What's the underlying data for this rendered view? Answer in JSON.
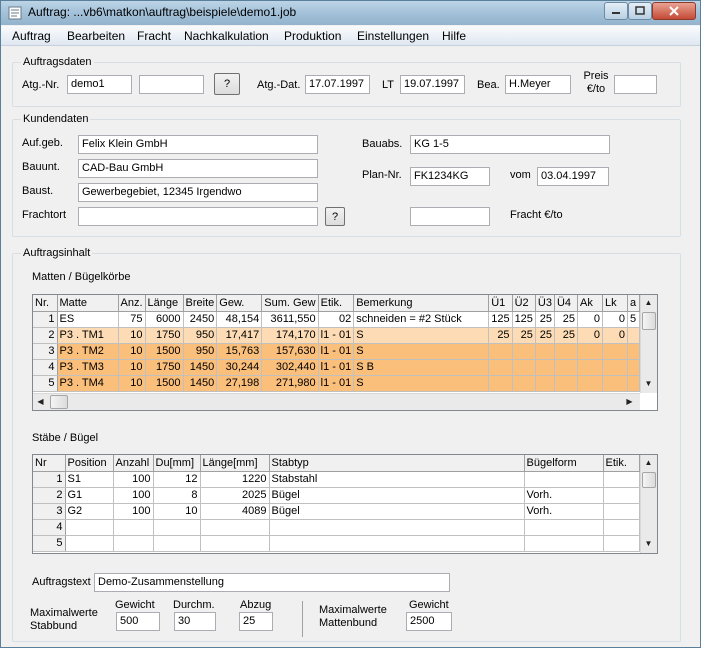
{
  "window": {
    "title": "Auftrag: ...vb6\\matkon\\auftrag\\beispiele\\demo1.job"
  },
  "menu": [
    "Auftrag",
    "Bearbeiten",
    "Fracht",
    "Nachkalkulation",
    "Produktion",
    "Einstellungen",
    "Hilfe"
  ],
  "auftragsdaten": {
    "group_label": "Auftragsdaten",
    "atg_nr_label": "Atg.-Nr.",
    "atg_nr_value": "demo1",
    "atg_nr_extra": "",
    "lookup_button": "?",
    "atg_dat_label": "Atg.-Dat.",
    "atg_dat_value": "17.07.1997",
    "lt_label": "LT",
    "lt_value": "19.07.1997",
    "bea_label": "Bea.",
    "bea_value": "H.Meyer",
    "preis_label_1": "Preis",
    "preis_label_2": "€/to",
    "preis_value": ""
  },
  "kundendaten": {
    "group_label": "Kundendaten",
    "aufgeb_label": "Auf.geb.",
    "aufgeb_value": "Felix Klein GmbH",
    "bauunt_label": "Bauunt.",
    "bauunt_value": "CAD-Bau  GmbH",
    "baust_label": "Baust.",
    "baust_value": "Gewerbegebiet, 12345 Irgendwo",
    "frachtort_label": "Frachtort",
    "frachtort_value": "",
    "frachtort_button": "?",
    "bauabs_label": "Bauabs.",
    "bauabs_value": "KG 1-5",
    "plannr_label": "Plan-Nr.",
    "plannr_value": "FK1234KG",
    "vom_label": "vom",
    "vom_value": "03.04.1997",
    "fracht_value": "",
    "fracht_label": "Fracht €/to"
  },
  "auftragsinhalt": {
    "group_label": "Auftragsinhalt",
    "matten_label": "Matten / Bügelkörbe",
    "matten_columns": [
      "Nr.",
      "Matte",
      "Anz.",
      "Länge",
      "Breite",
      "Gew.",
      "Sum. Gew",
      "Etik.",
      "Bemerkung",
      "Ü1",
      "Ü2",
      "Ü3",
      "Ü4",
      "Ak",
      "Lk",
      "a"
    ],
    "matten_rows": [
      {
        "nr": "1",
        "matte": "ES",
        "anz": "75",
        "laenge": "6000",
        "breite": "2450",
        "gew": "48,154",
        "sum": "3611,550",
        "etik": "02",
        "bem": "schneiden = #2 Stück",
        "u1": "125",
        "u2": "125",
        "u3": "25",
        "u4": "25",
        "ak": "0",
        "lk": "0",
        "a": "5"
      },
      {
        "nr": "2",
        "matte": "P3 . TM1",
        "anz": "10",
        "laenge": "1750",
        "breite": "950",
        "gew": "17,417",
        "sum": "174,170",
        "etik": "l1 - 01",
        "bem": "S",
        "u1": "25",
        "u2": "25",
        "u3": "25",
        "u4": "25",
        "ak": "0",
        "lk": "0",
        "a": ""
      },
      {
        "nr": "3",
        "matte": "P3 . TM2",
        "anz": "10",
        "laenge": "1500",
        "breite": "950",
        "gew": "15,763",
        "sum": "157,630",
        "etik": "l1 - 01",
        "bem": "S",
        "u1": "",
        "u2": "",
        "u3": "",
        "u4": "",
        "ak": "",
        "lk": "",
        "a": ""
      },
      {
        "nr": "4",
        "matte": "P3 . TM3",
        "anz": "10",
        "laenge": "1750",
        "breite": "1450",
        "gew": "30,244",
        "sum": "302,440",
        "etik": "l1 - 01",
        "bem": "S B",
        "u1": "",
        "u2": "",
        "u3": "",
        "u4": "",
        "ak": "",
        "lk": "",
        "a": ""
      },
      {
        "nr": "5",
        "matte": "P3 . TM4",
        "anz": "10",
        "laenge": "1500",
        "breite": "1450",
        "gew": "27,198",
        "sum": "271,980",
        "etik": "l1 - 01",
        "bem": "S",
        "u1": "",
        "u2": "",
        "u3": "",
        "u4": "",
        "ak": "",
        "lk": "",
        "a": ""
      }
    ],
    "staebe_label": "Stäbe / Bügel",
    "staebe_columns": [
      "Nr",
      "Position",
      "Anzahl",
      "Du[mm]",
      "Länge[mm]",
      "Stabtyp",
      "Bügelform",
      "Etik."
    ],
    "staebe_rows": [
      {
        "nr": "1",
        "pos": "S1",
        "anz": "100",
        "du": "12",
        "laenge": "1220",
        "typ": "Stabstahl",
        "form": "",
        "etik": ""
      },
      {
        "nr": "2",
        "pos": "G1",
        "anz": "100",
        "du": "8",
        "laenge": "2025",
        "typ": "Bügel",
        "form": "Vorh.",
        "etik": ""
      },
      {
        "nr": "3",
        "pos": "G2",
        "anz": "100",
        "du": "10",
        "laenge": "4089",
        "typ": "Bügel",
        "form": "Vorh.",
        "etik": ""
      },
      {
        "nr": "4",
        "pos": "",
        "anz": "",
        "du": "",
        "laenge": "",
        "typ": "",
        "form": "",
        "etik": ""
      },
      {
        "nr": "5",
        "pos": "",
        "anz": "",
        "du": "",
        "laenge": "",
        "typ": "",
        "form": "",
        "etik": ""
      }
    ],
    "auftragstext_label": "Auftragstext",
    "auftragstext_value": "Demo-Zusammenstellung",
    "maxwerte_stab_label_1": "Maximalwerte",
    "maxwerte_stab_label_2": "Stabbund",
    "gewicht_label": "Gewicht",
    "gewicht_value": "500",
    "durchm_label": "Durchm.",
    "durchm_value": "30",
    "abzug_label": "Abzug",
    "abzug_value": "25",
    "maxwerte_matten_label_1": "Maximalwerte",
    "maxwerte_matten_label_2": "Mattenbund",
    "gewicht_matten_label": "Gewicht",
    "gewicht_matten_value": "2500"
  }
}
